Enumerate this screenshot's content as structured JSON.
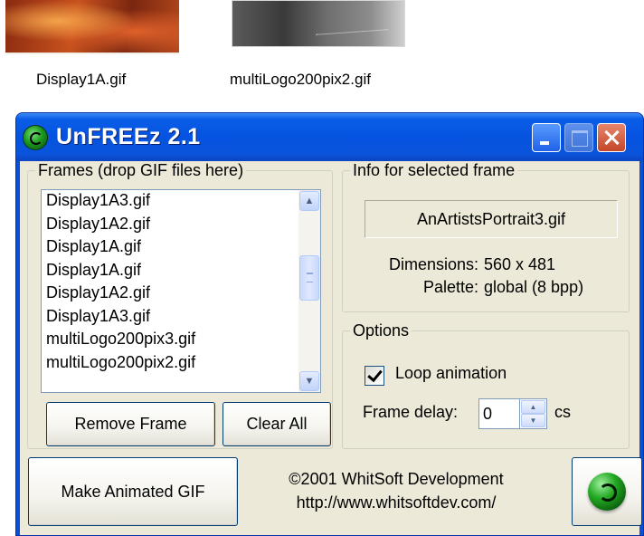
{
  "desktop": {
    "files": [
      {
        "label": "Display1A.gif"
      },
      {
        "label": "multiLogo200pix2.gif"
      }
    ]
  },
  "window": {
    "title": "UnFREEz 2.1"
  },
  "frames": {
    "legend": "Frames (drop GIF files here)",
    "items": [
      "Display1A3.gif",
      "Display1A2.gif",
      "Display1A.gif",
      "Display1A.gif",
      "Display1A2.gif",
      "Display1A3.gif",
      "multiLogo200pix3.gif",
      "multiLogo200pix2.gif"
    ],
    "remove_label": "Remove Frame",
    "clear_label": "Clear All"
  },
  "info": {
    "legend": "Info for selected frame",
    "filename": "AnArtistsPortrait3.gif",
    "dimensions_label": "Dimensions:",
    "dimensions_value": "560 x 481",
    "palette_label": "Palette:",
    "palette_value": "global (8 bpp)"
  },
  "options": {
    "legend": "Options",
    "loop_label": "Loop animation",
    "loop_checked": true,
    "delay_label": "Frame delay:",
    "delay_value": "0",
    "delay_unit": "cs"
  },
  "footer": {
    "make_label": "Make Animated GIF",
    "copyright": "©2001 WhitSoft Development",
    "url": "http://www.whitsoftdev.com/"
  },
  "icons": {
    "app": "unfreez-logo-icon",
    "scroll_up": "chevron-up-icon",
    "scroll_down": "chevron-down-icon"
  }
}
